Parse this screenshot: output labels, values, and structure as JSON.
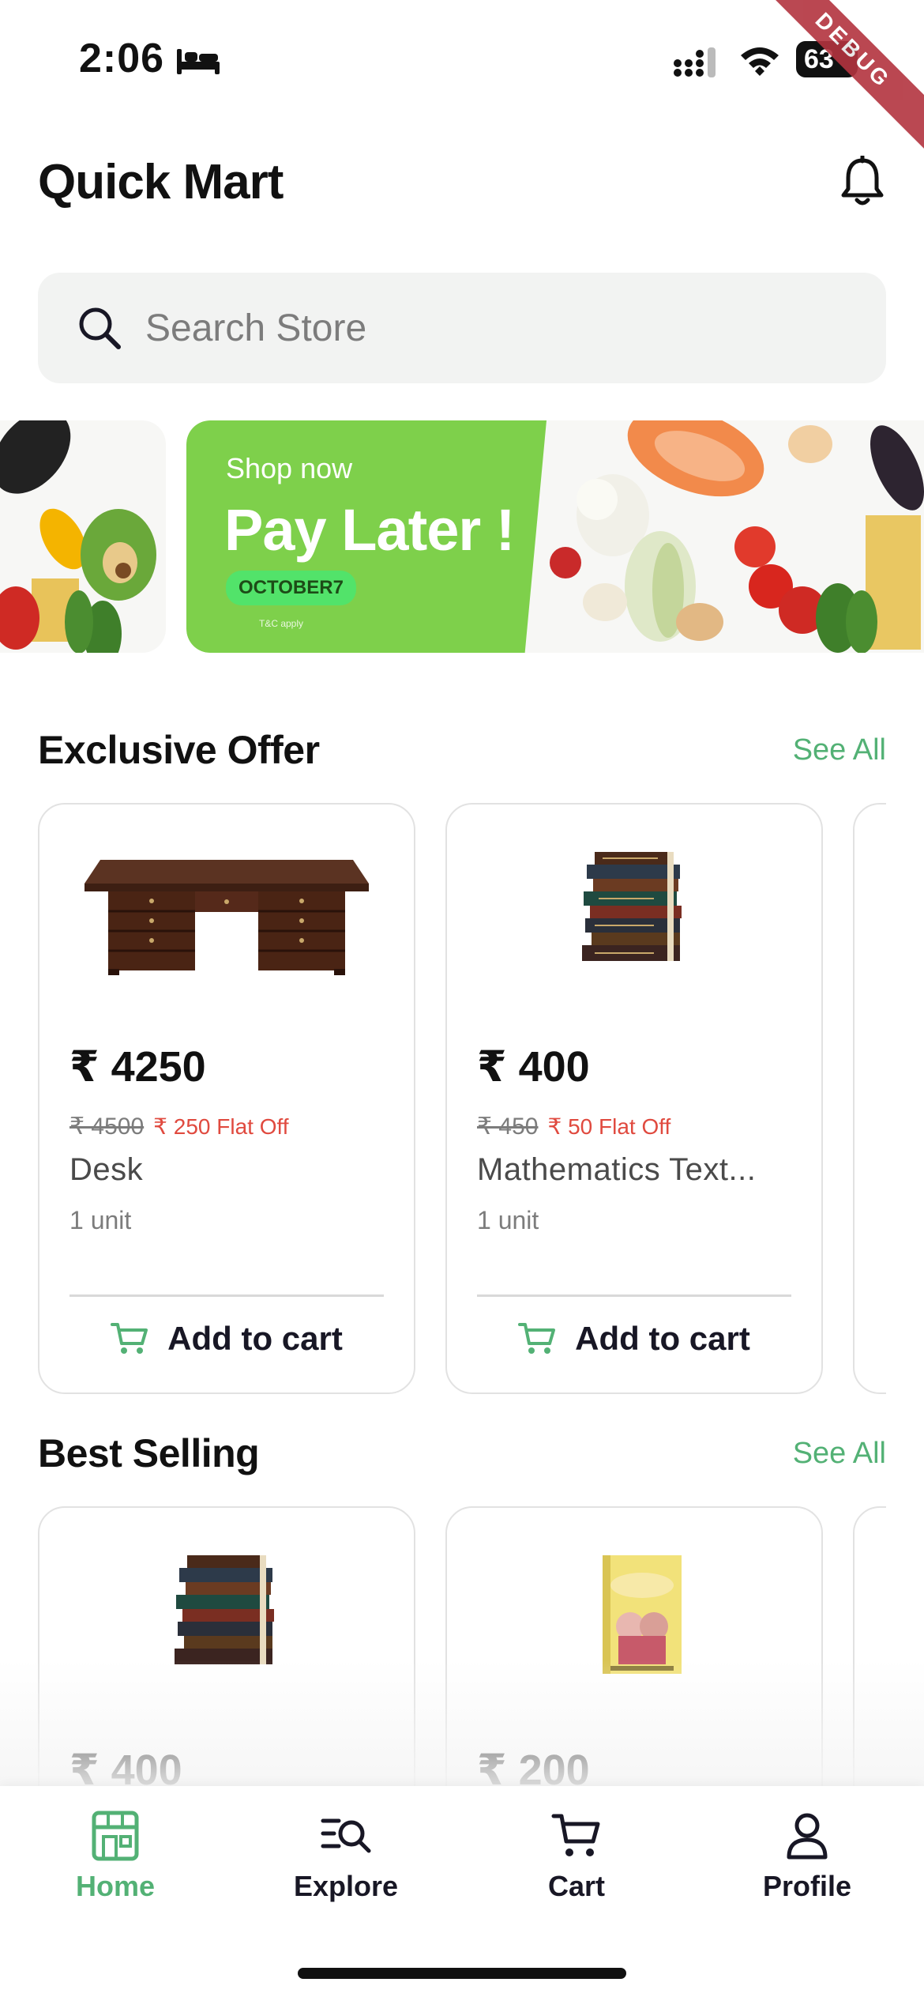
{
  "status_bar": {
    "time": "2:06",
    "battery": "63",
    "debug_label": "DEBUG"
  },
  "header": {
    "title": "Quick Mart",
    "bell_icon": "bell-icon"
  },
  "search": {
    "placeholder": "Search Store",
    "icon": "search-icon"
  },
  "banner": {
    "kicker": "Shop now",
    "headline": "Pay Later !",
    "code": "OCTOBER7",
    "terms": "T&C apply"
  },
  "exclusive_offer": {
    "title": "Exclusive Offer",
    "see_all": "See All",
    "products": [
      {
        "price": "₹ 4250",
        "old_price": "₹ 4500",
        "discount": "₹ 250 Flat Off",
        "name": "Desk",
        "unit": "1 unit",
        "add_label": "Add to cart"
      },
      {
        "price": "₹ 400",
        "old_price": "₹ 450",
        "discount": "₹ 50 Flat Off",
        "name": "Mathematics Text...",
        "unit": "1 unit",
        "add_label": "Add to cart"
      }
    ]
  },
  "best_selling": {
    "title": "Best Selling",
    "see_all": "See All",
    "products": [
      {
        "price": "₹ 400"
      },
      {
        "price": "₹ 200"
      }
    ]
  },
  "bottom_nav": {
    "items": [
      {
        "label": "Home",
        "icon": "store-icon",
        "active": true
      },
      {
        "label": "Explore",
        "icon": "explore-icon",
        "active": false
      },
      {
        "label": "Cart",
        "icon": "cart-icon",
        "active": false
      },
      {
        "label": "Profile",
        "icon": "profile-icon",
        "active": false
      }
    ]
  },
  "colors": {
    "accent": "#53b175",
    "banner_green": "#7ed04b",
    "discount_red": "#e04a3f"
  }
}
